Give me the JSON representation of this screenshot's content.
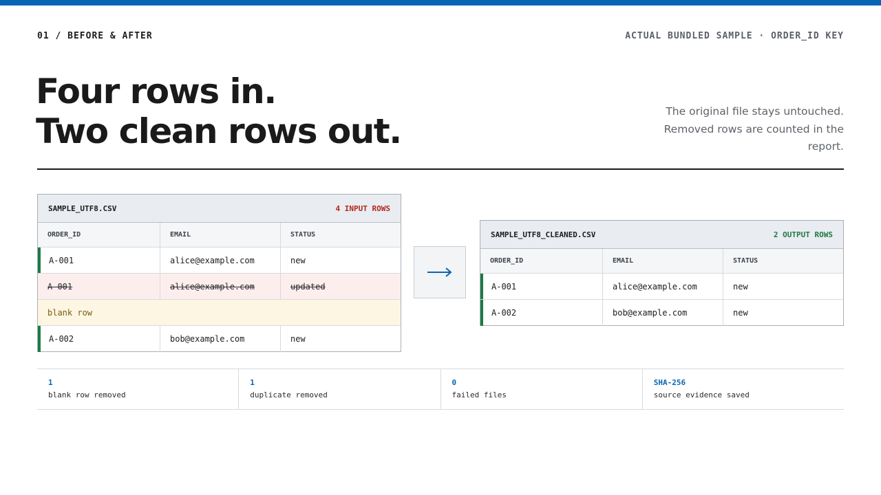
{
  "colors": {
    "accent": "#0a64b4",
    "kept_marker": "#1e7a46",
    "input_count": "#b3261e",
    "output_count": "#1e7a46",
    "duplicate_row_bg": "#fdeeee",
    "blank_row_bg": "#fdf6e3"
  },
  "header": {
    "section": "01 / BEFORE & AFTER",
    "context": "ACTUAL BUNDLED SAMPLE · ORDER_ID KEY"
  },
  "hero": {
    "line1": "Four rows in.",
    "line2": "Two clean rows out.",
    "subtext": "The original file stays untouched. Removed rows are counted in the report."
  },
  "input_panel": {
    "filename": "SAMPLE_UTF8.CSV",
    "count": "4 INPUT ROWS",
    "columns": [
      "ORDER_ID",
      "EMAIL",
      "STATUS"
    ],
    "rows": [
      {
        "state": "kept",
        "cells": [
          "A-001",
          "alice@example.com",
          "new"
        ]
      },
      {
        "state": "duplicate",
        "cells": [
          "A-001",
          "alice@example.com",
          "updated"
        ]
      },
      {
        "state": "blank",
        "label": "blank row"
      },
      {
        "state": "kept",
        "cells": [
          "A-002",
          "bob@example.com",
          "new"
        ]
      }
    ]
  },
  "transition": {
    "icon": "arrow-right-icon",
    "glyph": "→"
  },
  "output_panel": {
    "filename": "SAMPLE_UTF8_CLEANED.CSV",
    "count": "2 OUTPUT ROWS",
    "columns": [
      "ORDER_ID",
      "EMAIL",
      "STATUS"
    ],
    "rows": [
      {
        "state": "kept",
        "cells": [
          "A-001",
          "alice@example.com",
          "new"
        ]
      },
      {
        "state": "kept",
        "cells": [
          "A-002",
          "bob@example.com",
          "new"
        ]
      }
    ]
  },
  "stats": [
    {
      "value": "1",
      "label": "blank row removed"
    },
    {
      "value": "1",
      "label": "duplicate removed"
    },
    {
      "value": "0",
      "label": "failed files"
    },
    {
      "value": "SHA-256",
      "label": "source evidence saved"
    }
  ]
}
